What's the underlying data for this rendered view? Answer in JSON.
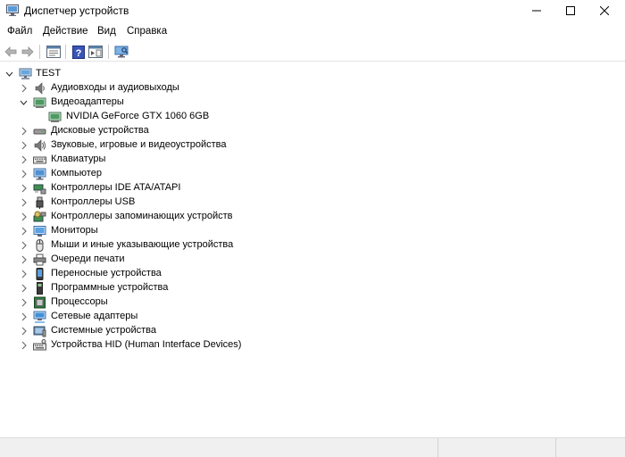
{
  "window": {
    "title": "Диспетчер устройств"
  },
  "menu": {
    "items": [
      "Файл",
      "Действие",
      "Вид",
      "Справка"
    ]
  },
  "toolbar": {
    "buttons": [
      "back-icon",
      "forward-icon",
      "properties-icon",
      "help-icon",
      "show-hidden-icon",
      "scan-hardware-icon"
    ]
  },
  "tree": {
    "root": {
      "label": "TEST",
      "expanded": true
    },
    "categories": [
      {
        "label": "Аудиовходы и аудиовыходы",
        "icon": "audio-icon",
        "expanded": false
      },
      {
        "label": "Видеоадаптеры",
        "icon": "display-adapter-icon",
        "expanded": true,
        "children": [
          {
            "label": "NVIDIA GeForce GTX 1060 6GB",
            "icon": "display-adapter-icon"
          }
        ]
      },
      {
        "label": "Дисковые устройства",
        "icon": "disk-icon",
        "expanded": false
      },
      {
        "label": "Звуковые, игровые и видеоустройства",
        "icon": "sound-icon",
        "expanded": false
      },
      {
        "label": "Клавиатуры",
        "icon": "keyboard-icon",
        "expanded": false
      },
      {
        "label": "Компьютер",
        "icon": "computer-icon",
        "expanded": false
      },
      {
        "label": "Контроллеры IDE ATA/ATAPI",
        "icon": "ide-controller-icon",
        "expanded": false
      },
      {
        "label": "Контроллеры USB",
        "icon": "usb-icon",
        "expanded": false
      },
      {
        "label": "Контроллеры запоминающих устройств",
        "icon": "storage-controller-icon",
        "expanded": false
      },
      {
        "label": "Мониторы",
        "icon": "monitor-icon",
        "expanded": false
      },
      {
        "label": "Мыши и иные указывающие устройства",
        "icon": "mouse-icon",
        "expanded": false
      },
      {
        "label": "Очереди печати",
        "icon": "printer-icon",
        "expanded": false
      },
      {
        "label": "Переносные устройства",
        "icon": "portable-device-icon",
        "expanded": false
      },
      {
        "label": "Программные устройства",
        "icon": "software-device-icon",
        "expanded": false
      },
      {
        "label": "Процессоры",
        "icon": "processor-icon",
        "expanded": false
      },
      {
        "label": "Сетевые адаптеры",
        "icon": "network-adapter-icon",
        "expanded": false
      },
      {
        "label": "Системные устройства",
        "icon": "system-device-icon",
        "expanded": false
      },
      {
        "label": "Устройства HID (Human Interface Devices)",
        "icon": "hid-icon",
        "expanded": false
      }
    ]
  },
  "colors": {
    "accent": "#2f74c0",
    "status_bar": "#f0f0f0"
  }
}
